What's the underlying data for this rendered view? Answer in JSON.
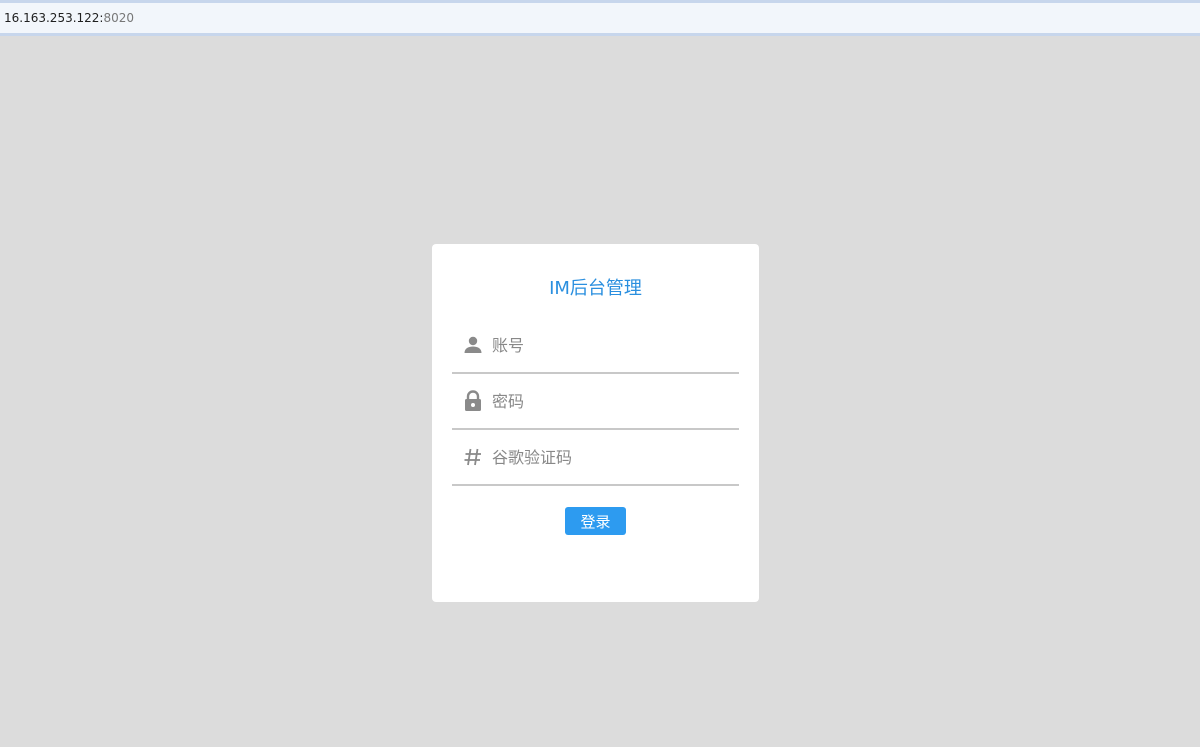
{
  "browser": {
    "url_host": "16.163.253.122:",
    "url_port": "8020"
  },
  "login": {
    "title": "IM后台管理",
    "account": {
      "placeholder": "账号",
      "value": "",
      "icon": "user-icon"
    },
    "password": {
      "placeholder": "密码",
      "value": "",
      "icon": "lock-icon"
    },
    "captcha": {
      "placeholder": "谷歌验证码",
      "value": "",
      "icon": "hash-icon"
    },
    "submit_label": "登录"
  },
  "colors": {
    "accent": "#2d9bf0",
    "title": "#2a8fdf",
    "page_background": "#dcdcdc",
    "card_background": "#ffffff",
    "icon": "#8a8a8a"
  }
}
